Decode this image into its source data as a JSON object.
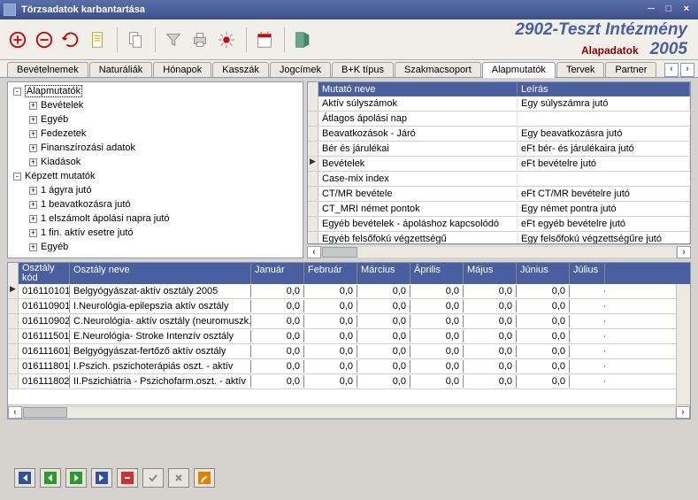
{
  "window": {
    "title": "Törzsadatok karbantartása"
  },
  "header": {
    "institution": "2902-Teszt Intézmény",
    "subtitle": "Alapadatok",
    "year": "2005"
  },
  "tabs": {
    "items": [
      "Bevételnemek",
      "Naturáliák",
      "Hónapok",
      "Kasszák",
      "Jogcímek",
      "B+K típus",
      "Szakmacsoport",
      "Alapmutatók",
      "Tervek",
      "Partner"
    ],
    "active": 7
  },
  "tree": {
    "nodes": [
      {
        "lvl": 0,
        "exp": "-",
        "label": "Alapmutatók",
        "sel": true
      },
      {
        "lvl": 1,
        "exp": "+",
        "label": "Bevételek"
      },
      {
        "lvl": 1,
        "exp": "+",
        "label": "Egyéb"
      },
      {
        "lvl": 1,
        "exp": "+",
        "label": "Fedezetek"
      },
      {
        "lvl": 1,
        "exp": "+",
        "label": "Finanszírozási adatok"
      },
      {
        "lvl": 1,
        "exp": "+",
        "label": "Kiadások"
      },
      {
        "lvl": 0,
        "exp": "-",
        "label": "Képzett mutatók"
      },
      {
        "lvl": 1,
        "exp": "+",
        "label": "1 ágyra jutó"
      },
      {
        "lvl": 1,
        "exp": "+",
        "label": "1 beavatkozásra jutó"
      },
      {
        "lvl": 1,
        "exp": "+",
        "label": "1 elszámolt ápolási napra jutó"
      },
      {
        "lvl": 1,
        "exp": "+",
        "label": "1 fin. aktív esetre jutó"
      },
      {
        "lvl": 1,
        "exp": "+",
        "label": "Egyéb"
      }
    ]
  },
  "grid1": {
    "cols": [
      "Mutató neve",
      "Leírás"
    ],
    "rows": [
      {
        "c0": "Aktív súlyszámok",
        "c1": "Egy súlyszámra jutó"
      },
      {
        "c0": "Átlagos ápolási nap",
        "c1": ""
      },
      {
        "c0": "Beavatkozások - Járó",
        "c1": "Egy beavatkozásra jutó"
      },
      {
        "c0": "Bér és járulékai",
        "c1": "eFt bér- és járulékaira jutó"
      },
      {
        "c0": "Bevételek",
        "c1": "eFt bevételre jutó",
        "mark": "▶"
      },
      {
        "c0": "Case-mix index",
        "c1": ""
      },
      {
        "c0": "CT/MR bevétele",
        "c1": "eFt CT/MR bevételre jutó"
      },
      {
        "c0": "CT_MRI német pontok",
        "c1": "Egy német pontra jutó"
      },
      {
        "c0": "Egyéb bevételek - ápoláshoz kapcsolódó",
        "c1": "eFt egyéb bevételre jutó"
      },
      {
        "c0": "Egyéb felsőfokú végzettségű",
        "c1": "Egy felsőfokú végzettségűre jutó"
      }
    ]
  },
  "grid2": {
    "cols": [
      "Osztály kód",
      "Osztály neve",
      "Január",
      "Február",
      "Március",
      "Április",
      "Május",
      "Június",
      "Július"
    ],
    "rows": [
      {
        "kod": "016110101",
        "nev": "Belgyógyászat-aktív osztály 2005",
        "v": [
          "0,0",
          "0,0",
          "0,0",
          "0,0",
          "0,0",
          "0,0",
          ""
        ],
        "mark": "▶"
      },
      {
        "kod": "016110901",
        "nev": "I.Neurológia-epilepszia aktív osztály",
        "v": [
          "0,0",
          "0,0",
          "0,0",
          "0,0",
          "0,0",
          "0,0",
          ""
        ]
      },
      {
        "kod": "016110902",
        "nev": "C.Neurológia- aktív osztály (neuromuszk.)",
        "v": [
          "0,0",
          "0,0",
          "0,0",
          "0,0",
          "0,0",
          "0,0",
          ""
        ]
      },
      {
        "kod": "016111501",
        "nev": "E.Neurológia- Stroke Intenzív osztály",
        "v": [
          "0,0",
          "0,0",
          "0,0",
          "0,0",
          "0,0",
          "0,0",
          ""
        ]
      },
      {
        "kod": "016111601",
        "nev": "Belgyógyászat-fertőző aktív osztály",
        "v": [
          "0,0",
          "0,0",
          "0,0",
          "0,0",
          "0,0",
          "0,0",
          ""
        ]
      },
      {
        "kod": "016111801",
        "nev": "I.Pszich. pszichoterápiás oszt. - aktív",
        "v": [
          "0,0",
          "0,0",
          "0,0",
          "0,0",
          "0,0",
          "0,0",
          ""
        ]
      },
      {
        "kod": "016111802",
        "nev": "II.Pszichiátria - Pszichofarm.oszt. - aktív",
        "v": [
          "0,0",
          "0,0",
          "0,0",
          "0,0",
          "0,0",
          "0,0",
          ""
        ]
      }
    ]
  }
}
